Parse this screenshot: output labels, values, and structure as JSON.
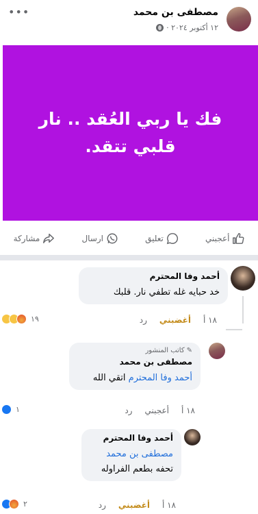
{
  "post": {
    "author": "مصطفى بن محمد",
    "date": "١٢ أكتوبر ٢٠٢٤ ·",
    "more": "•••",
    "image_text": "فك يا ربي العُقد .. نار قلبي تتقد.",
    "image_color": "#b012e0"
  },
  "actions": {
    "like": "أعجبني",
    "comment": "تعليق",
    "send": "ارسال",
    "share": "مشاركة"
  },
  "comments": [
    {
      "name": "أحمد وفا المحترم",
      "text": "خد حبايه غله تطفي نار. قلبك",
      "time": "١٨ أ",
      "reaction_label": "أغضبني",
      "reply": "رد",
      "reaction_count": "١٩"
    },
    {
      "badge": "كاتب المنشور",
      "name": "مصطفى بن محمد",
      "mention": "أحمد وفا المحترم",
      "text": "اتقي الله",
      "time": "١٨ أ",
      "reaction_label": "أعجبني",
      "reply": "رد",
      "reaction_count": "١"
    },
    {
      "name": "أحمد وفا المحترم",
      "mention": "مصطفى بن محمد",
      "text": "تحفه بطعم الفراوله",
      "time": "١٨ أ",
      "reaction_label": "أغضبني",
      "reply": "رد",
      "reaction_count": "٢"
    }
  ]
}
